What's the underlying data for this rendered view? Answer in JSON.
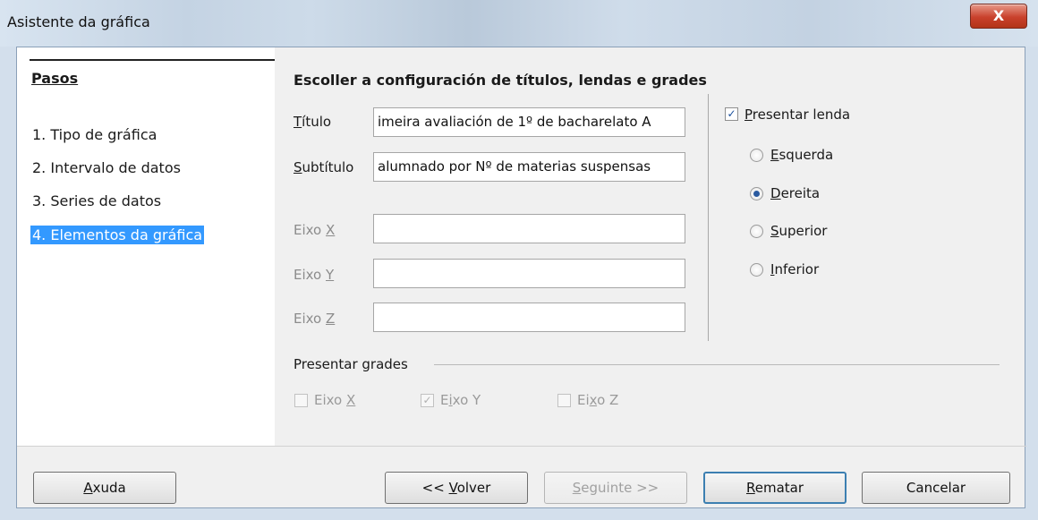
{
  "window": {
    "title": "Asistente da gráfica",
    "close_label": "X"
  },
  "steps": {
    "heading": "Pasos",
    "items": [
      {
        "label": "1. Tipo de gráfica",
        "active": false
      },
      {
        "label": "2. Intervalo de datos",
        "active": false
      },
      {
        "label": "3. Series de datos",
        "active": false
      },
      {
        "label": "4. Elementos da gráfica",
        "active": true
      }
    ]
  },
  "content": {
    "heading": "Escoller a configuración de títulos, lendas e grades",
    "fields": {
      "title": {
        "label_mnemonic": "T",
        "label_rest": "ítulo",
        "value": "imeira avaliación de 1º de bacharelato A"
      },
      "subtitle": {
        "label_mnemonic": "S",
        "label_rest": "ubtítulo",
        "value": "alumnado por Nº de materias suspensas"
      },
      "x_axis": {
        "label_prefix": "Eixo ",
        "label_mnemonic": "X",
        "value": ""
      },
      "y_axis": {
        "label_prefix": "Eixo ",
        "label_mnemonic": "Y",
        "value": ""
      },
      "z_axis": {
        "label_prefix": "Eixo ",
        "label_mnemonic": "Z",
        "value": ""
      }
    },
    "legend": {
      "checkbox_mnemonic": "P",
      "checkbox_rest": "resentar lenda",
      "checked": true,
      "check_glyph": "✓",
      "options": [
        {
          "mnemonic": "E",
          "rest": "squerda",
          "selected": false
        },
        {
          "mnemonic": "D",
          "rest": "ereita",
          "selected": true
        },
        {
          "mnemonic": "S",
          "rest": "uperior",
          "selected": false
        },
        {
          "mnemonic": "I",
          "rest": "nferior",
          "selected": false
        }
      ]
    },
    "grids": {
      "label": "Presentar grades",
      "x": {
        "prefix": "Eixo ",
        "mnemonic": "X",
        "rest": "",
        "checked": false
      },
      "y": {
        "prefix": "E",
        "mnemonic": "i",
        "rest": "xo Y",
        "checked": true
      },
      "z": {
        "prefix": "Ei",
        "mnemonic": "x",
        "rest": "o Z",
        "checked": false
      }
    }
  },
  "buttons": {
    "help": {
      "mnemonic": "A",
      "rest": "xuda"
    },
    "back": {
      "prefix": "<< ",
      "mnemonic": "V",
      "rest": "olver"
    },
    "next": {
      "mnemonic": "S",
      "rest": "eguinte >>"
    },
    "finish": {
      "mnemonic": "R",
      "rest": "ematar"
    },
    "cancel": {
      "label": "Cancelar"
    }
  }
}
